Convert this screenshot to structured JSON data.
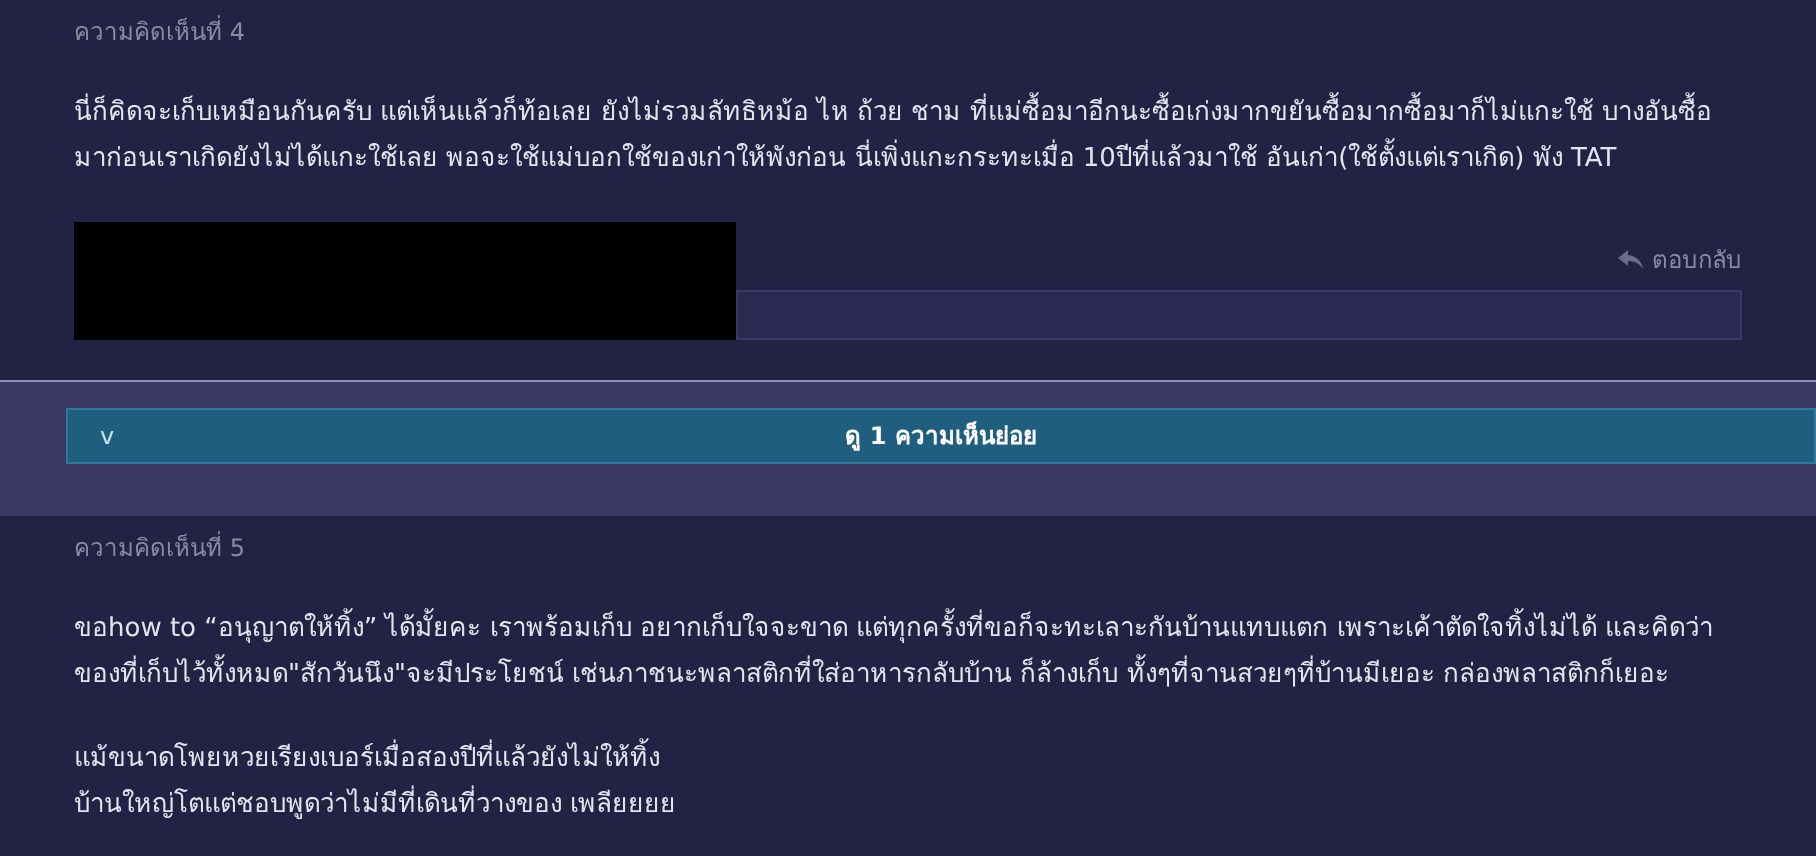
{
  "comments": [
    {
      "label": "ความคิดเห็นที่ 4",
      "paragraphs": [
        [
          "นี่ก็คิดจะเก็บเหมือนกันครับ แต่เห็นแล้วก็ท้อเลย ยังไม่รวมลัทธิหม้อ ไห ถ้วย ชาม ที่แม่ซื้อมาอีกนะซื้อเก่งมากขยันซื้อมากซื้อมาก็ไม่แกะใช้ บางอันซื้อ",
          "มาก่อนเราเกิดยังไม่ได้แกะใช้เลย พอจะใช้แม่บอกใช้ของเก่าให้พังก่อน นี่เพิ่งแกะกระทะเมื่อ 10ปีที่แล้วมาใช้ อันเก่า(ใช้ตั้งแต่เราเกิด) พัง TAT"
        ]
      ],
      "reply": "ตอบกลับ",
      "subcomments": {
        "toggle": "v",
        "label": "ดู 1 ความเห็นย่อย"
      }
    },
    {
      "label": "ความคิดเห็นที่ 5",
      "paragraphs": [
        [
          "ขอhow to “อนุญาตให้ทิ้ง” ได้มั้ยคะ เราพร้อมเก็บ อยากเก็บใจจะขาด แต่ทุกครั้งที่ขอก็จะทะเลาะกันบ้านแทบแตก เพราะเค้าตัดใจทิ้งไม่ได้ และคิดว่า",
          "ของที่เก็บไว้ทั้งหมด\"สักวันนึง\"จะมีประโยชน์ เช่นภาชนะพลาสติกที่ใส่อาหารกลับบ้าน ก็ล้างเก็บ ทั้งๆที่จานสวยๆที่บ้านมีเยอะ กล่องพลาสติกก็เยอะ"
        ],
        [
          "แม้ขนาดโพยหวยเรียงเบอร์เมื่อสองปีที่แล้วยังไม่ให้ทิ้ง",
          "บ้านใหญ่โตแต่ชอบพูดว่าไม่มีที่เดินที่วางของ เพลียยยย"
        ]
      ]
    }
  ]
}
